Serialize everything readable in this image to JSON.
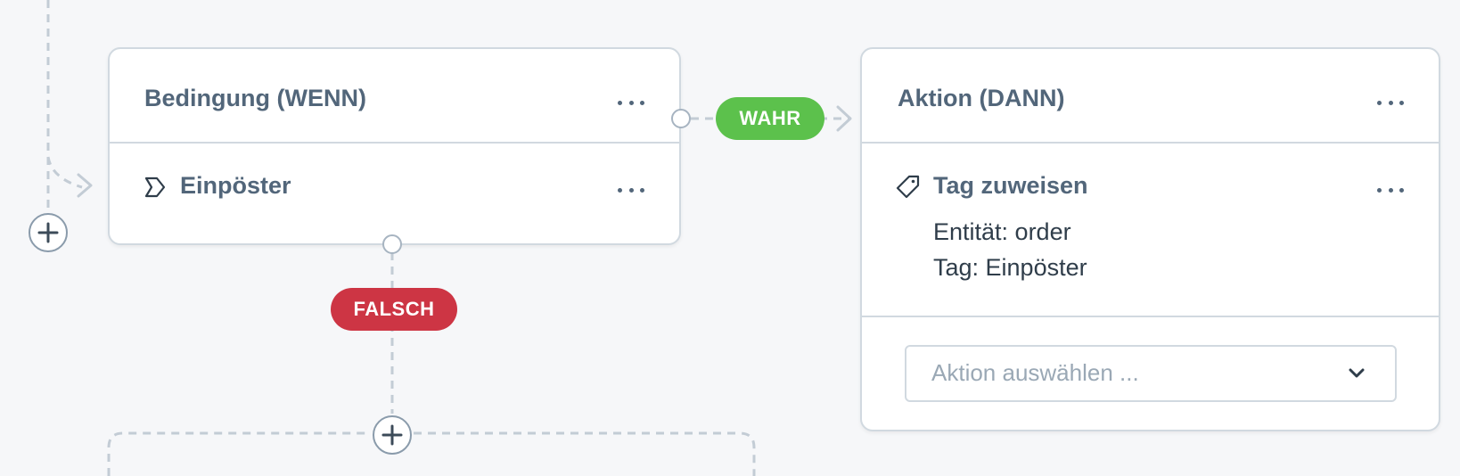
{
  "flow": {
    "condition_card": {
      "title": "Bedingung (WENN)",
      "rule_label": "Einpöster",
      "rule_icon": "rule-tag-icon"
    },
    "action_card": {
      "title": "Aktion (DANN)",
      "action_label": "Tag zuweisen",
      "action_icon": "tag-icon",
      "details": [
        "Entität: order",
        "Tag: Einpöster"
      ],
      "select_placeholder": "Aktion auswählen ..."
    },
    "branches": {
      "true_label": "WAHR",
      "false_label": "FALSCH"
    }
  },
  "colors": {
    "true": "#5cc14c",
    "false": "#cd3544",
    "border": "#d1d9e0",
    "text": "#52667a",
    "connector": "#c3ccd5"
  }
}
